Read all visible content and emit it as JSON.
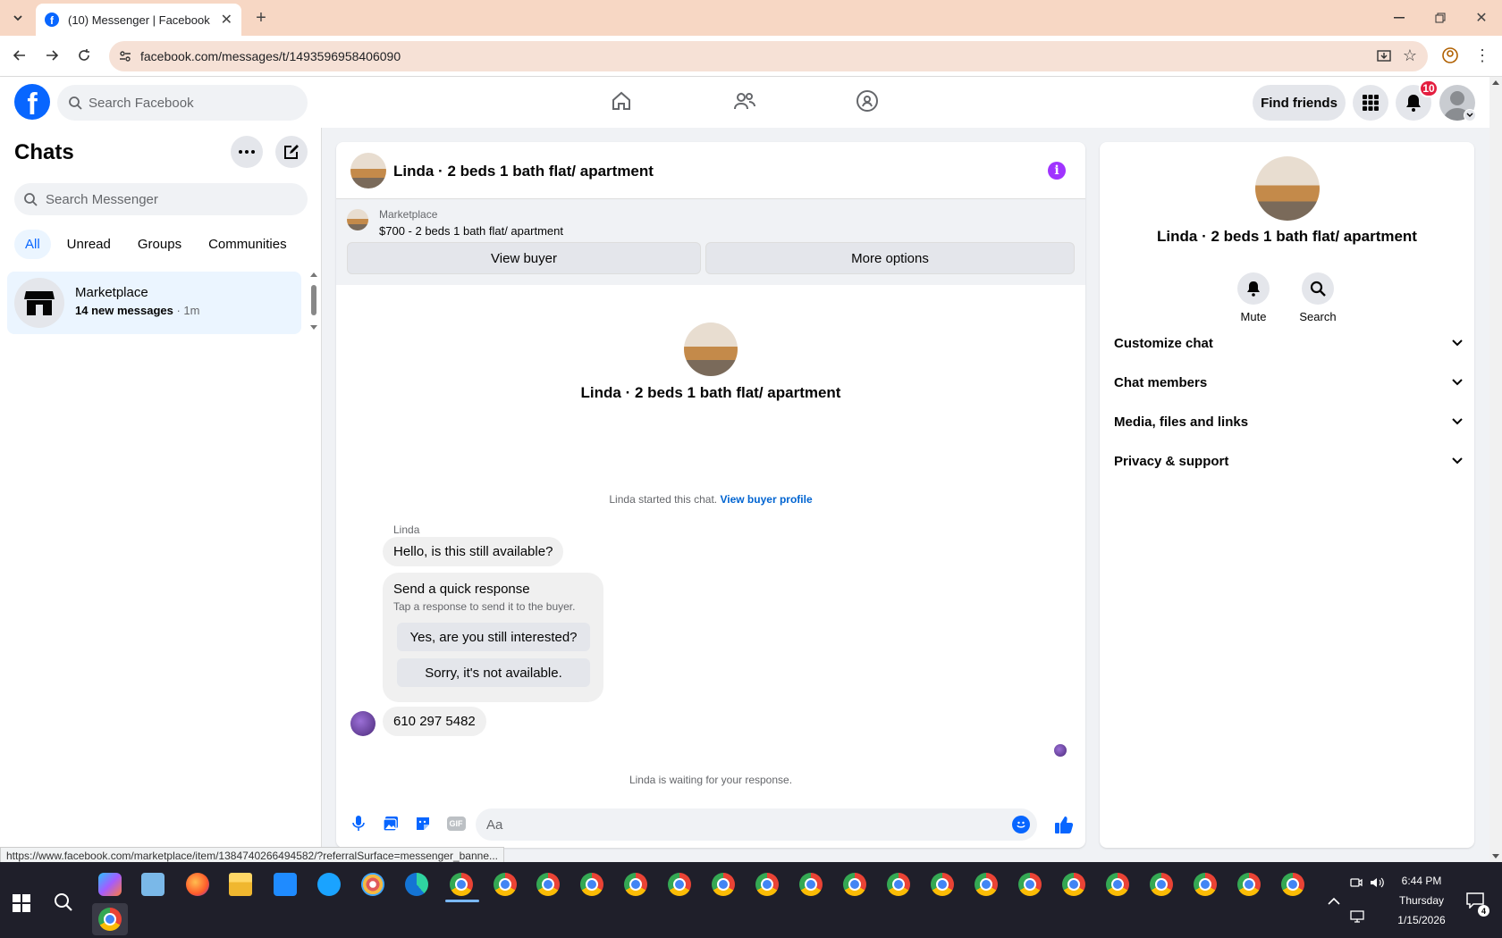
{
  "browser": {
    "tab_title": "(10) Messenger | Facebook",
    "url": "facebook.com/messages/t/1493596958406090",
    "status_url": "https://www.facebook.com/marketplace/item/1384740266494582/?referralSurface=messenger_banne..."
  },
  "header": {
    "search_placeholder": "Search Facebook",
    "find_friends": "Find friends",
    "notification_count": "10"
  },
  "sidebar": {
    "title": "Chats",
    "search_placeholder": "Search Messenger",
    "filters": [
      "All",
      "Unread",
      "Groups",
      "Communities"
    ],
    "chats": [
      {
        "name": "Marketplace",
        "preview": "14 new messages",
        "time": "1m"
      }
    ]
  },
  "conversation": {
    "title": "Linda · 2 beds 1 bath flat/ apartment",
    "banner_label": "Marketplace",
    "banner_item": "$700 - 2 beds 1 bath flat/ apartment",
    "view_buyer": "View buyer",
    "more_options": "More options",
    "intro_name": "Linda · 2 beds 1 bath flat/ apartment",
    "started_text": "Linda started this chat.",
    "view_profile": "View buyer profile",
    "sender_name": "Linda",
    "message_1": "Hello, is this still available?",
    "quick_title": "Send a quick response",
    "quick_sub": "Tap a response to send it to the buyer.",
    "quick_1": "Yes, are you still interested?",
    "quick_2": "Sorry, it's not available.",
    "message_2": "610 297 5482",
    "waiting": "Linda is waiting for your response.",
    "composer_placeholder": "Aa"
  },
  "info_panel": {
    "name": "Linda · 2 beds 1 bath flat/ apartment",
    "mute": "Mute",
    "search": "Search",
    "sections": [
      "Customize chat",
      "Chat members",
      "Media, files and links",
      "Privacy & support"
    ]
  },
  "taskbar": {
    "time": "6:44 PM",
    "day": "Thursday",
    "date": "1/15/2026",
    "notif_count": "4"
  },
  "colors": {
    "fb_blue": "#0866ff",
    "accent_purple": "#a033ff"
  }
}
